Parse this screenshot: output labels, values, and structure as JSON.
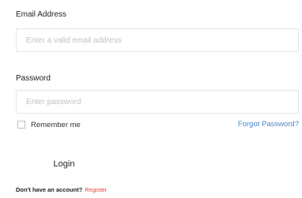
{
  "form": {
    "email": {
      "label": "Email Address",
      "placeholder": "Enter a valid email address",
      "value": ""
    },
    "password": {
      "label": "Password",
      "placeholder": "Enter password",
      "value": ""
    },
    "remember_me": {
      "label": "Remember me",
      "checked": false
    },
    "forgot_password_label": "Forgot Password?",
    "login_button_label": "Login",
    "signup_prompt": "Don't have an account?",
    "register_label": "Register"
  },
  "colors": {
    "link": "#4a86c8",
    "register": "#e0453a",
    "input_border": "#e4e4e4",
    "placeholder": "#c2c2c2"
  }
}
